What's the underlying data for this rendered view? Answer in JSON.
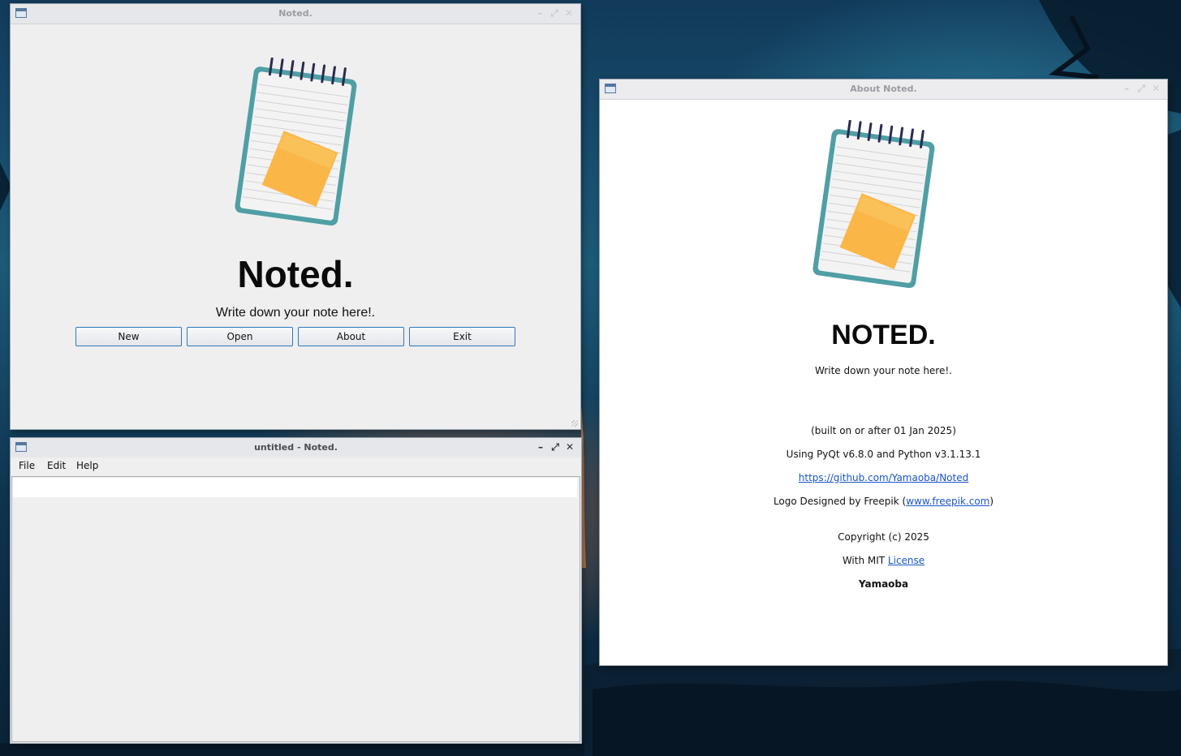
{
  "colors": {
    "accent": "#2f7ab8",
    "link": "#1a55c8",
    "window_bg": "#efeff0",
    "about_bg": "#ffffff"
  },
  "main_window": {
    "title": "Noted.",
    "app_title": "Noted.",
    "tagline": "Write down your note here!.",
    "buttons": {
      "new": "New",
      "open": "Open",
      "about": "About",
      "exit": "Exit"
    },
    "icons": [
      "notepad-logo",
      "minimize-icon",
      "maximize-icon",
      "close-icon"
    ]
  },
  "editor_window": {
    "title": "untitled - Noted.",
    "menu": {
      "file": "File",
      "edit": "Edit",
      "help": "Help"
    },
    "controls": {
      "minimize": "–",
      "maximize": "⤢",
      "close": "✕"
    }
  },
  "about_window": {
    "title": "About Noted.",
    "app_title": "NOTED.",
    "tagline": "Write down your note here!.",
    "build": "(built on or after 01 Jan 2025)",
    "versions": "Using PyQt v6.8.0 and Python v3.1.13.1",
    "repo_url": "https://github.com/Yamaoba/Noted",
    "logo_credit_prefix": "Logo Designed by Freepik (",
    "logo_credit_link": "www.freepik.com",
    "logo_credit_suffix": ")",
    "copyright": "Copyright (c) 2025",
    "license_prefix": "With MIT ",
    "license_link": "License",
    "author": "Yamaoba"
  }
}
